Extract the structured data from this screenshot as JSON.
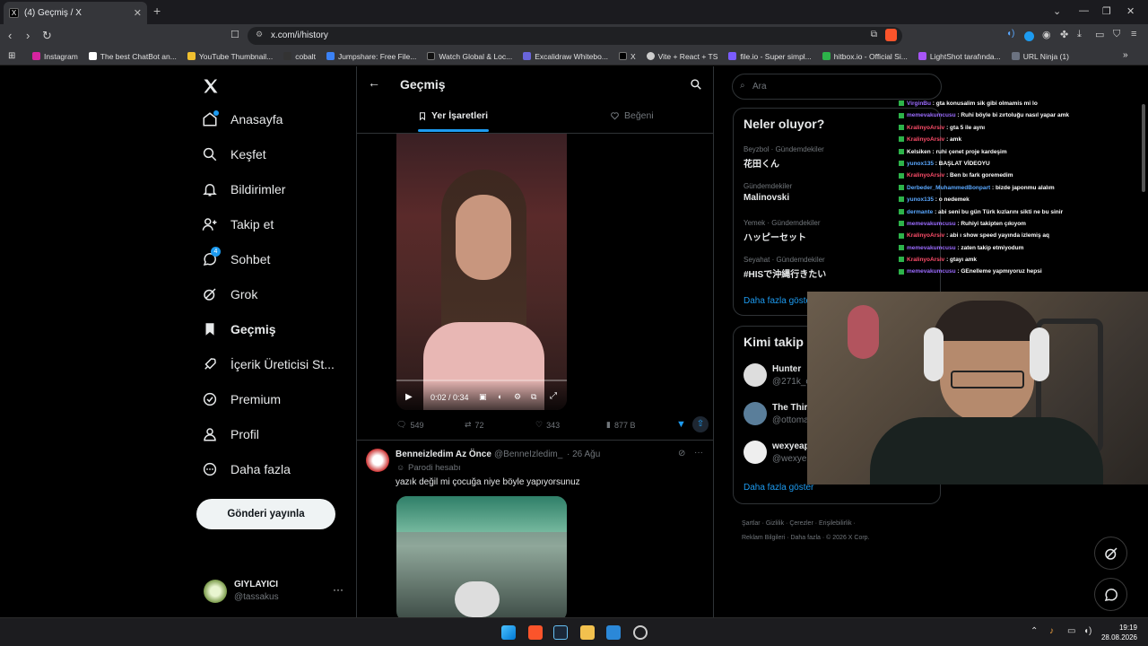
{
  "browser": {
    "tab_title": "(4) Geçmiş / X",
    "url": "x.com/i/history",
    "bookmarks": [
      "Instagram",
      "The best ChatBot an...",
      "YouTube Thumbnail...",
      "cobalt",
      "Jumpshare: Free File...",
      "Watch Global & Loc...",
      "Excalidraw Whitebo...",
      "X",
      "Vite + React + TS",
      "file.io - Super simpl...",
      "hitbox.io - Official Si...",
      "LightShot tarafında...",
      "URL Ninja (1)"
    ]
  },
  "nav": {
    "items": [
      {
        "label": "Anasayfa"
      },
      {
        "label": "Keşfet"
      },
      {
        "label": "Bildirimler"
      },
      {
        "label": "Takip et"
      },
      {
        "label": "Sohbet"
      },
      {
        "label": "Grok"
      },
      {
        "label": "Geçmiş"
      },
      {
        "label": "İçerik Üreticisi St..."
      },
      {
        "label": "Premium"
      },
      {
        "label": "Profil"
      },
      {
        "label": "Daha fazla"
      }
    ],
    "post_button": "Gönderi yayınla",
    "chat_badge": "4",
    "account": {
      "name": "GIYLAYICI",
      "handle": "@tassakus"
    }
  },
  "center": {
    "title": "Geçmiş",
    "tabs": [
      "Yer İşaretleri",
      "Beğeni"
    ],
    "video": {
      "time": "0:02 / 0:34"
    },
    "stats": {
      "replies": "549",
      "reposts": "72",
      "likes": "343",
      "views": "877 B"
    },
    "tweet2": {
      "name": "Benneizledim Az Önce",
      "handle": "@BenneIzledim_",
      "date": "· 26 Ağu",
      "label": "Parodi hesabı",
      "text": "yazık değil mi çocuğa niye böyle yapıyorsunuz"
    }
  },
  "right": {
    "search_placeholder": "Ara",
    "trends_title": "Neler oluyor?",
    "trends": [
      {
        "context": "Beyzbol · Gündemdekiler",
        "title": "花田くん"
      },
      {
        "context": "Gündemdekiler",
        "title": "Malinovski"
      },
      {
        "context": "Yemek · Gündemdekiler",
        "title": "ハッピーセット"
      },
      {
        "context": "Seyahat · Gündemdekiler",
        "title": "#HISで沖縄行きたい"
      }
    ],
    "show_more": "Daha fazla göster",
    "who_title": "Kimi takip e",
    "who": [
      {
        "name": "Hunter",
        "handle": "@271k_o"
      },
      {
        "name": "The Thir",
        "handle": "@ottoma"
      },
      {
        "name": "wexyeap",
        "handle": "@wexyea"
      }
    ],
    "who_more": "Daha fazla göster",
    "footer": [
      "Şartlar",
      "Gizlilik",
      "Çerezler",
      "Erişilebilirlik",
      "Reklam Bilgileri",
      "Daha fazla",
      "© 2026 X Corp."
    ]
  },
  "chat_overlay": [
    {
      "user": "VirginBu",
      "color": "#9b6bff",
      "msg": ": gta konusalim sik gibi olmamis mi lo"
    },
    {
      "user": "memevakumcusu",
      "color": "#9b6bff",
      "msg": ": Ruhi böyle bi zırtoluğu nasıl yapar amk"
    },
    {
      "user": "KralinyoArsiv",
      "color": "#ff4d6a",
      "msg": ": gta 5 ile aynı"
    },
    {
      "user": "KralinyoArsiv",
      "color": "#ff4d6a",
      "msg": ": amk"
    },
    {
      "user": "Kelsiken",
      "color": "#ffffff",
      "msg": ": ruhi çenet proje kardeşim"
    },
    {
      "user": "yunox135",
      "color": "#5aa8ff",
      "msg": ": BAŞLAT VİDEOYU"
    },
    {
      "user": "KralinyoArsiv",
      "color": "#ff4d6a",
      "msg": ": Ben bı fark goremedim"
    },
    {
      "user": "Derbeder_MuhammedBonpart",
      "color": "#5aa8ff",
      "msg": ": bizde japonmu alalım"
    },
    {
      "user": "yunox135",
      "color": "#5aa8ff",
      "msg": ": o nedemek"
    },
    {
      "user": "dermante",
      "color": "#5aa8ff",
      "msg": ": abi seni bu gün Türk kızlarını sikti ne bu sinir"
    },
    {
      "user": "memevakumcusu",
      "color": "#9b6bff",
      "msg": ": Ruhiyi takipten çıkıyom"
    },
    {
      "user": "KralinyoArsiv",
      "color": "#ff4d6a",
      "msg": ": abi ı show speed yayında izlemiş aq"
    },
    {
      "user": "memevakumcusu",
      "color": "#9b6bff",
      "msg": ": zaten takip etmiyodum"
    },
    {
      "user": "KralinyoArsiv",
      "color": "#ff4d6a",
      "msg": ": gtayı amk"
    },
    {
      "user": "memevakumcusu",
      "color": "#9b6bff",
      "msg": ": GEnelleme yapmıyoruz hepsi"
    }
  ],
  "taskbar": {
    "time": "19:19",
    "date": "28.08.2026"
  }
}
